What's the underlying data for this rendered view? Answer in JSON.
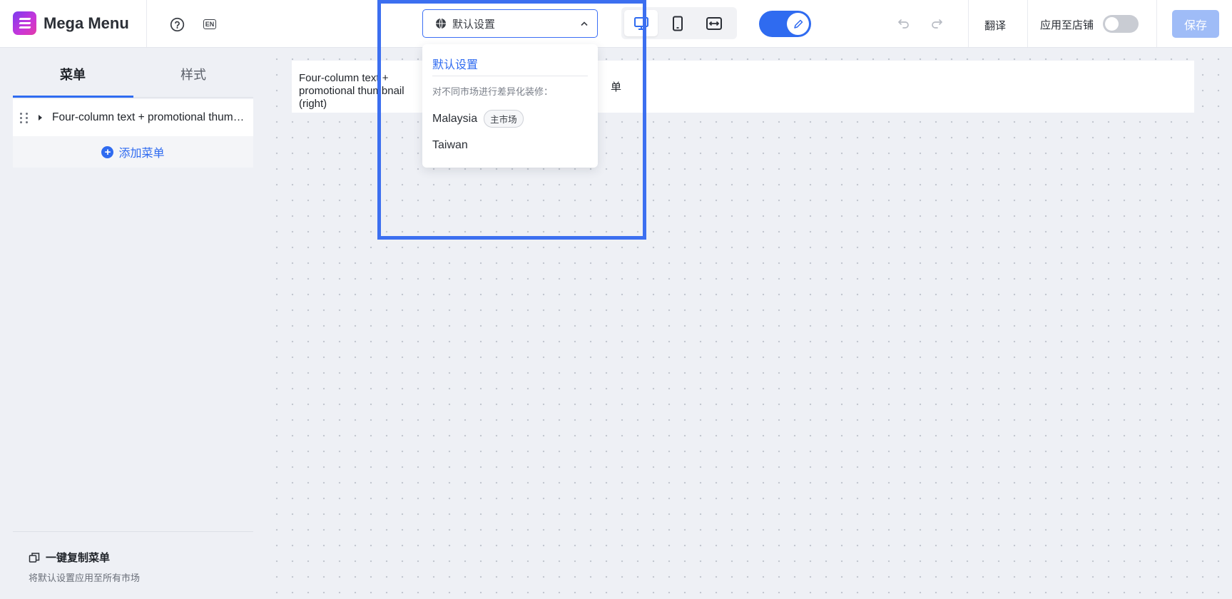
{
  "app": {
    "name": "Mega Menu",
    "lang_badge": "EN"
  },
  "market_select": {
    "value": "默认设置"
  },
  "toolbar": {
    "translate_label": "翻译",
    "apply_store_label": "应用至店铺",
    "save_label": "保存"
  },
  "sidebar": {
    "tabs": [
      {
        "label": "菜单"
      },
      {
        "label": "样式"
      }
    ],
    "items": [
      {
        "label": "Four-column text + promotional thumbnail (right)"
      }
    ],
    "add_label": "添加菜单",
    "copy_title": "一键复制菜单",
    "copy_sub": "将默认设置应用至所有市场"
  },
  "canvas": {
    "preview_text": "Four-column text + promotional thumbnail (right)",
    "preview_tail": "单"
  },
  "dropdown": {
    "default_label": "默认设置",
    "hint": "对不同市场进行差异化装修：",
    "options": [
      {
        "label": "Malaysia",
        "badge": "主市场"
      },
      {
        "label": "Taiwan"
      }
    ]
  },
  "colors": {
    "accent": "#2f6bf0",
    "highlight": "#3c6ff0",
    "save_disabled": "#9fbcf7"
  }
}
